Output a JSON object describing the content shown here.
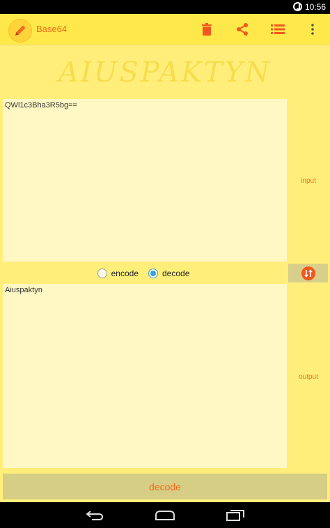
{
  "status_bar": {
    "time": "10:56",
    "sync_icon": "sync-icon"
  },
  "app_bar": {
    "title": "Base64",
    "icons": [
      "pencil-icon",
      "delete-icon",
      "share-icon",
      "list-icon",
      "more-vert-icon"
    ]
  },
  "banner": {
    "text": "AIUSPAKTYN"
  },
  "input": {
    "value": "QWl1c3Bha3R5bg==",
    "side_label": "input"
  },
  "mode": {
    "options": [
      {
        "label": "encode",
        "checked": false
      },
      {
        "label": "decode",
        "checked": true
      }
    ]
  },
  "swap": {
    "icon": "swap-icon"
  },
  "output": {
    "value": "Aiuspaktyn",
    "side_label": "output"
  },
  "action_button": {
    "label": "decode"
  },
  "colors": {
    "background": "#FFEF7A",
    "app_bar": "#FFE94A",
    "accent": "#F06B1C",
    "text_area": "#FFF8C4",
    "button": "#D6CE84"
  },
  "nav_bar": {
    "icons": [
      "back-icon",
      "home-icon",
      "recents-icon"
    ]
  }
}
